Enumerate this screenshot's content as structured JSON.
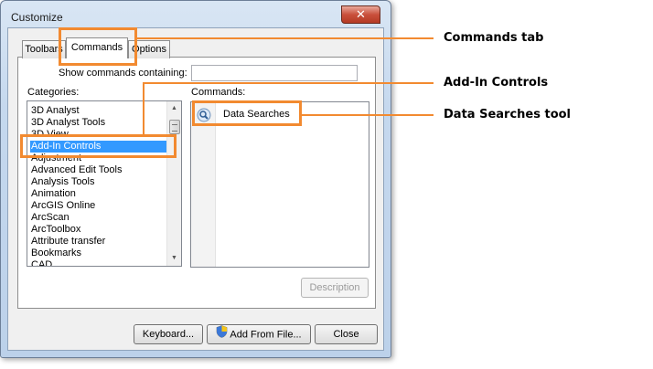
{
  "window": {
    "title": "Customize",
    "close_glyph": "✕"
  },
  "tabs": [
    {
      "label": "Toolbars"
    },
    {
      "label": "Commands"
    },
    {
      "label": "Options"
    }
  ],
  "search": {
    "label": "Show commands containing:",
    "value": ""
  },
  "categories": {
    "label": "Categories:",
    "items": [
      "3D Analyst",
      "3D Analyst Tools",
      "3D View",
      "Add-In Controls",
      "Adjustment",
      "Advanced Edit Tools",
      "Analysis Tools",
      "Animation",
      "ArcGIS Online",
      "ArcScan",
      "ArcToolbox",
      "Attribute transfer",
      "Bookmarks",
      "CAD"
    ],
    "selected": "Add-In Controls"
  },
  "commands": {
    "label": "Commands:",
    "items": [
      {
        "label": "Data Searches",
        "icon": "magnifier-icon"
      }
    ]
  },
  "buttons": {
    "description": "Description",
    "keyboard": "Keyboard...",
    "add_from_file": "Add From File...",
    "close": "Close"
  },
  "callouts": {
    "commands_tab": "Commands tab",
    "add_in_controls": "Add-In Controls",
    "data_searches": "Data Searches tool"
  },
  "colors": {
    "callout": "#f28a30",
    "selection": "#3399ff"
  }
}
